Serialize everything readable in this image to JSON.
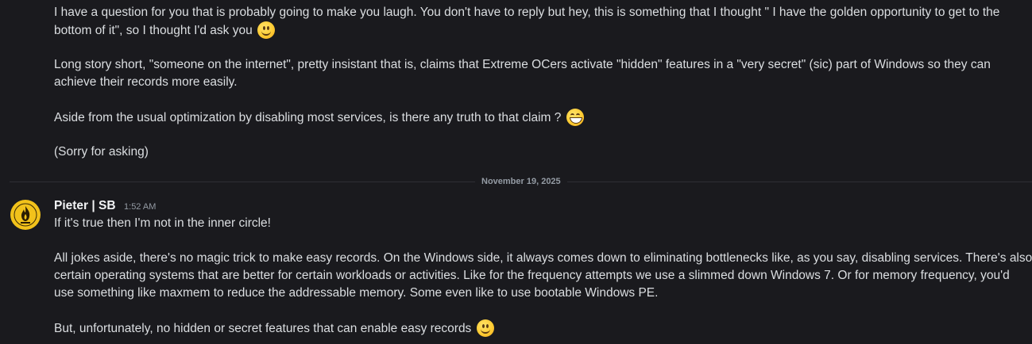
{
  "previous_message": {
    "paragraph_1": {
      "line_1": "I have a question for you that is probably going to make you laugh. You don't have to reply but hey, this is something that I thought \" I have the golden opportunity to get to the",
      "line_2": "bottom of it\", so I thought I'd ask you",
      "emoji": "slight-smile-icon"
    },
    "paragraph_2": {
      "line_1": "Long story short, \"someone on the internet\", pretty insistant that is, claims that Extreme OCers activate \"hidden\" features in a \"very secret\" (sic) part of Windows so they can",
      "line_2": "achieve their records more easily."
    },
    "paragraph_3": {
      "line_1": "Aside from the usual optimization by disabling most services, is there any truth to that claim ?",
      "emoji": "grin-icon"
    },
    "paragraph_4": {
      "line_1": "(Sorry for asking)"
    }
  },
  "date_divider": "November 19, 2025",
  "reply": {
    "username": "Pieter | SB",
    "timestamp": "1:52 AM",
    "paragraph_1": {
      "line_1": "If it's true then I'm not in the inner circle!"
    },
    "paragraph_2": {
      "line_1": "All jokes aside, there's no magic trick to make easy records. On the Windows side, it always comes down to eliminating bottlenecks like, as you say, disabling services. There's also",
      "line_2": "certain operating systems that are better for certain workloads or activities. Like for the frequency attempts we use a slimmed down Windows 7. Or for memory frequency, you'd",
      "line_3": "use something like maxmem to reduce the addressable memory. Some even like to use bootable Windows PE."
    },
    "paragraph_3": {
      "line_1": "But, unfortunately, no hidden or secret features that can enable easy records",
      "emoji": "slight-smile-icon"
    }
  },
  "colors": {
    "background": "#1a1a1e",
    "text": "#dbdee1",
    "muted": "#949ba4",
    "avatar": "#f2c21b"
  }
}
